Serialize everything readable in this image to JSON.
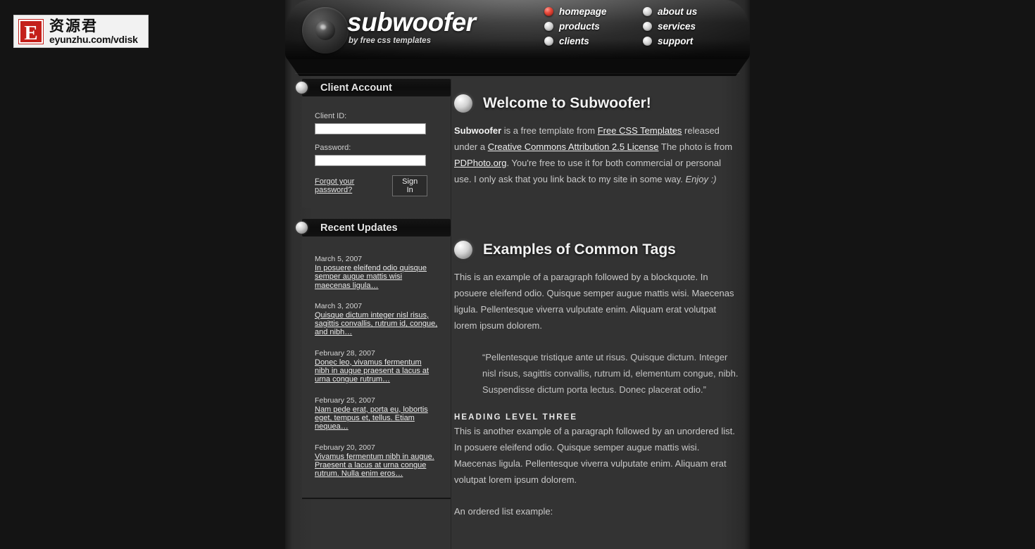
{
  "watermark": {
    "badge_letter": "E",
    "chinese": "资源君",
    "url": "eyunzhu.com/vdisk",
    "badge_color": "#c4201b"
  },
  "header": {
    "brand_title": "subwoofer",
    "brand_subtitle": "by free css templates",
    "cone_icon": "speaker-cone-icon",
    "nav": {
      "active_bullet_color": "#e8483a",
      "columns": [
        {
          "items": [
            {
              "label": "homepage",
              "active": true,
              "bullet_icon": "nav-bullet-icon"
            },
            {
              "label": "products",
              "active": false,
              "bullet_icon": "nav-bullet-icon"
            },
            {
              "label": "clients",
              "active": false,
              "bullet_icon": "nav-bullet-icon"
            }
          ]
        },
        {
          "items": [
            {
              "label": "about us",
              "active": false,
              "bullet_icon": "nav-bullet-icon"
            },
            {
              "label": "services",
              "active": false,
              "bullet_icon": "nav-bullet-icon"
            },
            {
              "label": "support",
              "active": false,
              "bullet_icon": "nav-bullet-icon"
            }
          ]
        }
      ]
    }
  },
  "sidebar": {
    "client_account": {
      "heading": "Client Account",
      "bullet_icon": "section-bullet-icon",
      "client_id_label": "Client ID:",
      "client_id_value": "",
      "client_id_placeholder": "",
      "password_label": "Password:",
      "password_value": "",
      "password_placeholder": "",
      "forgot_link": "Forgot your password?",
      "signin_label": "Sign In"
    },
    "recent_updates": {
      "heading": "Recent Updates",
      "bullet_icon": "section-bullet-icon",
      "items": [
        {
          "date": "March 5, 2007",
          "text": "In posuere eleifend odio quisque semper augue mattis wisi maecenas ligula…"
        },
        {
          "date": "March 3, 2007",
          "text": "Quisque dictum integer nisl risus, sagittis convallis, rutrum id, congue, and nibh…"
        },
        {
          "date": "February 28, 2007",
          "text": "Donec leo, vivamus fermentum nibh in augue praesent a lacus at urna congue rutrum…"
        },
        {
          "date": "February 25, 2007",
          "text": "Nam pede erat, porta eu, lobortis eget, tempus et, tellus. Etiam nequea…"
        },
        {
          "date": "February 20, 2007",
          "text": "Vivamus fermentum nibh in augue. Praesent a lacus at urna congue rutrum. Nulla enim eros…"
        }
      ]
    }
  },
  "main": {
    "welcome": {
      "heading": "Welcome to Subwoofer!",
      "bullet_icon": "section-bullet-icon",
      "p1_strong": "Subwoofer",
      "p1_a": " is a free template from ",
      "link_free_css": "Free CSS Templates",
      "p1_b": " released under a ",
      "link_license": "Creative Commons Attribution 2.5 License",
      "p1_c": " The photo is from ",
      "link_pdphoto": "PDPhoto.org",
      "p1_d": ". You're free to use it for both commercial or personal use. I only ask that you link back to my site in some way. ",
      "p1_em": "Enjoy :)"
    },
    "tags": {
      "heading": "Examples of Common Tags",
      "bullet_icon": "section-bullet-icon",
      "paragraph1": "This is an example of a paragraph followed by a blockquote. In posuere eleifend odio. Quisque semper augue mattis wisi. Maecenas ligula. Pellentesque viverra vulputate enim. Aliquam erat volutpat lorem ipsum dolorem.",
      "blockquote": "“Pellentesque tristique ante ut risus. Quisque dictum. Integer nisl risus, sagittis convallis, rutrum id, elementum congue, nibh. Suspendisse dictum porta lectus. Donec placerat odio.”",
      "heading3": "Heading Level Three",
      "paragraph2": "This is another example of a paragraph followed by an unordered list. In posuere eleifend odio. Quisque semper augue mattis wisi. Maecenas ligula. Pellentesque viverra vulputate enim. Aliquam erat volutpat lorem ipsum dolorem.",
      "paragraph3": "An ordered list example:"
    }
  }
}
